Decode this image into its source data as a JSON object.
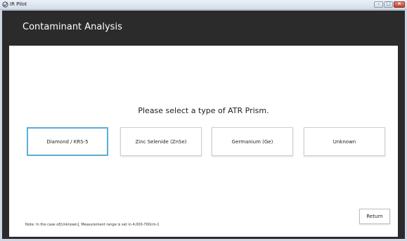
{
  "window": {
    "title": "IR Pilot",
    "icon": "ir-pilot-app-icon",
    "controls": {
      "minimize_icon": "minimize-icon",
      "maximize_icon": "maximize-icon",
      "close_icon": "close-icon"
    }
  },
  "header": {
    "title": "Contaminant Analysis"
  },
  "main": {
    "prompt": "Please select a type of ATR Prism.",
    "prisms": [
      {
        "label": "Diamond / KRS-5",
        "selected": true
      },
      {
        "label": "Zinc Selenide (ZnSe)",
        "selected": false
      },
      {
        "label": "Germanium (Ge)",
        "selected": false
      },
      {
        "label": "Unknown",
        "selected": false
      }
    ],
    "note": "Note: In the case of[Unknown], Measurement range is set in 4,000-700cm-1",
    "return_label": "Return"
  },
  "colors": {
    "header_bg": "#2b2b2b",
    "content_bg": "#ffffff",
    "selected_border": "#5aaed6"
  }
}
